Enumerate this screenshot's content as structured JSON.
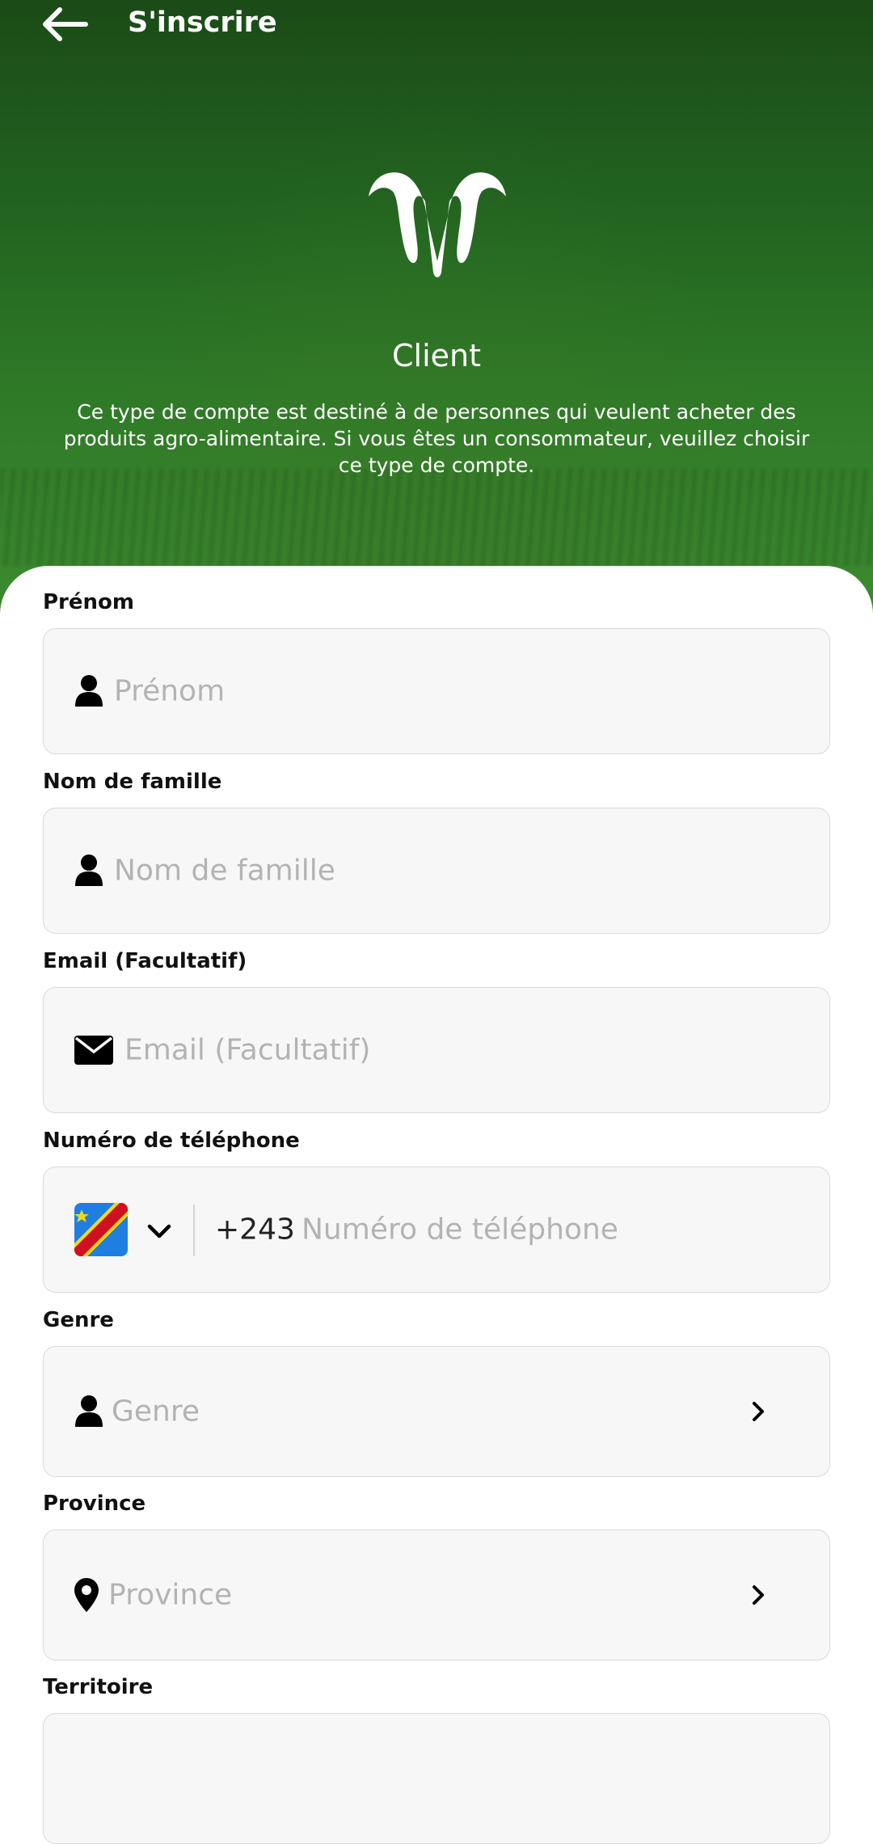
{
  "header": {
    "title": "S'inscrire"
  },
  "account": {
    "type": "Client",
    "description": "Ce type de compte est destiné à de personnes qui veulent acheter des produits agro-alimentaire. Si vous êtes un consommateur, veuillez choisir ce type de compte."
  },
  "form": {
    "first_name": {
      "label": "Prénom",
      "placeholder": "Prénom"
    },
    "last_name": {
      "label": "Nom de famille",
      "placeholder": "Nom de famille"
    },
    "email": {
      "label": "Email (Facultatif)",
      "placeholder": "Email (Facultatif)"
    },
    "phone": {
      "label": "Numéro de téléphone",
      "dial_code": "+243",
      "placeholder": "Numéro de téléphone"
    },
    "gender": {
      "label": "Genre",
      "placeholder": "Genre"
    },
    "province": {
      "label": "Province",
      "placeholder": "Province"
    },
    "territory": {
      "label": "Territoire"
    }
  },
  "icons": {
    "back": "arrow-left-icon",
    "logo": "ram-logo-icon",
    "person": "person-icon",
    "email": "envelope-icon",
    "flag": "drc-flag-icon",
    "dropdown": "chevron-down-icon",
    "next": "chevron-right-icon",
    "location": "location-pin-icon"
  },
  "colors": {
    "hero_green": "#226420",
    "field_bg": "#f7f7f7",
    "placeholder": "#b3b3b3"
  }
}
